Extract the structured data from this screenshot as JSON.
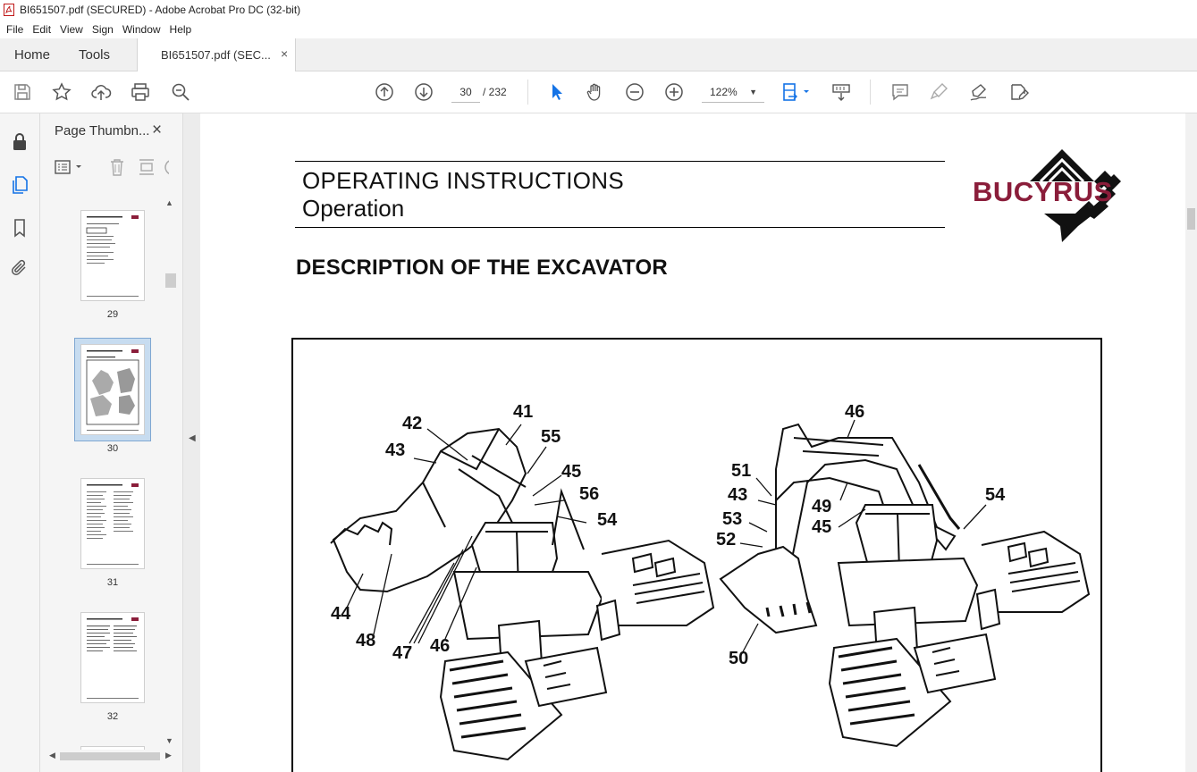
{
  "window": {
    "title": "BI651507.pdf (SECURED) - Adobe Acrobat Pro DC (32-bit)"
  },
  "menu": {
    "items": [
      "File",
      "Edit",
      "View",
      "Sign",
      "Window",
      "Help"
    ]
  },
  "tabs": {
    "home": "Home",
    "tools": "Tools",
    "document": "BI651507.pdf (SEC...",
    "close_glyph": "×"
  },
  "toolbar": {
    "current_page": "30",
    "total_pages": "/ 232",
    "zoom": "122%",
    "icons": [
      "save-icon",
      "star-icon",
      "upload-icon",
      "print-icon",
      "zoom-search-icon",
      "page-up-icon",
      "page-down-icon",
      "select-pointer-icon",
      "hand-icon",
      "zoom-out-icon",
      "zoom-in-icon",
      "fit-page-icon",
      "scroll-mode-icon",
      "comment-icon",
      "highlight-icon",
      "sign-icon",
      "fill-sign-icon"
    ]
  },
  "left_rail": {
    "icons": [
      "lock-icon",
      "pages-icon",
      "bookmark-icon",
      "attachment-icon"
    ]
  },
  "thumbnails": {
    "title": "Page Thumbn...",
    "close_glyph": "×",
    "pages": [
      {
        "number": "29",
        "selected": false
      },
      {
        "number": "30",
        "selected": true
      },
      {
        "number": "31",
        "selected": false
      },
      {
        "number": "32",
        "selected": false
      }
    ]
  },
  "document": {
    "header_line1": "OPERATING INSTRUCTIONS",
    "header_line2": "Operation",
    "heading": "DESCRIPTION OF THE EXCAVATOR",
    "logo_text": "BUCYRUS",
    "logo_reg": "®",
    "callouts_left": [
      "41",
      "42",
      "43",
      "55",
      "45",
      "56",
      "54",
      "44",
      "48",
      "47",
      "46"
    ],
    "callouts_right": [
      "46",
      "51",
      "43",
      "49",
      "45",
      "54",
      "53",
      "52",
      "50"
    ]
  },
  "colors": {
    "brand": "#8a1d3a",
    "selection": "#c7dcf0",
    "accent_blue": "#1473e6"
  }
}
